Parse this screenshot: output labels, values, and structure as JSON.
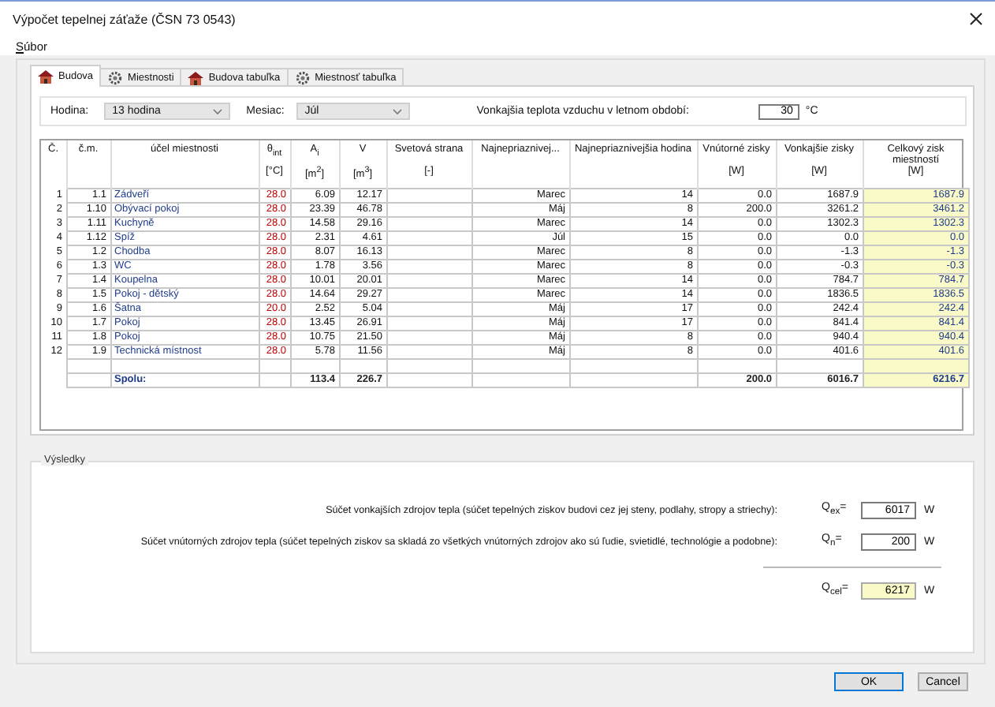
{
  "window": {
    "title": "Výpočet tepelnej záťaže  (ČSN 73 0543)"
  },
  "menu": [
    {
      "label": "Súbor"
    }
  ],
  "tabs": [
    {
      "label": "Budova",
      "kind": "building",
      "selected": true
    },
    {
      "label": "Miestnosti",
      "kind": "rooms",
      "selected": false
    },
    {
      "label": "Budova tabuľka",
      "kind": "building",
      "selected": false
    },
    {
      "label": "Miestnosť tabuľka",
      "kind": "rooms",
      "selected": false
    }
  ],
  "filters": {
    "hour": {
      "label": "Hodina:",
      "value": "13 hodina"
    },
    "month": {
      "label": "Mesiac:",
      "value": "Júl"
    },
    "outdoor_temperature": {
      "label": "Vonkajšia teplota vzduchu v letnom období:",
      "value": "30",
      "unit": "°C"
    }
  },
  "table": {
    "columns": [
      {
        "header": "Č."
      },
      {
        "header": "č.m."
      },
      {
        "header": "účel miestnosti"
      },
      {
        "header": "θ$_{int}$",
        "unit": "[°C]"
      },
      {
        "header": "A$_{i}$",
        "unit": "[m$^{2}$]"
      },
      {
        "header": "V",
        "unit": "[m$^{3}$]"
      },
      {
        "header": "Svetová strana",
        "unit": "[-]"
      },
      {
        "header": "Najnepriaznivej..."
      },
      {
        "header": "Najnepriaznivejšia hodina"
      },
      {
        "header": "Vnútorné zisky",
        "unit": "[W]"
      },
      {
        "header": "Vonkajšie zisky",
        "unit": "[W]"
      },
      {
        "header": "Celkový zisk miestností",
        "unit": "[W]"
      }
    ],
    "rows": [
      [
        "1",
        "1.1",
        "Zádveří",
        "28.0",
        "6.09",
        "12.17",
        null,
        "Marec",
        "14",
        "0.0",
        "1687.9",
        "1687.9"
      ],
      [
        "2",
        "1.10",
        "Obývací pokoj",
        "28.0",
        "23.39",
        "46.78",
        null,
        "Máj",
        "8",
        "200.0",
        "3261.2",
        "3461.2"
      ],
      [
        "3",
        "1.11",
        "Kuchyně",
        "28.0",
        "14.58",
        "29.16",
        null,
        "Marec",
        "14",
        "0.0",
        "1302.3",
        "1302.3"
      ],
      [
        "4",
        "1.12",
        "Spíž",
        "28.0",
        "2.31",
        "4.61",
        null,
        "Júl",
        "15",
        "0.0",
        "0.0",
        "0.0"
      ],
      [
        "5",
        "1.2",
        "Chodba",
        "28.0",
        "8.07",
        "16.13",
        null,
        "Marec",
        "8",
        "0.0",
        "-1.3",
        "-1.3"
      ],
      [
        "6",
        "1.3",
        "WC",
        "28.0",
        "1.78",
        "3.56",
        null,
        "Marec",
        "8",
        "0.0",
        "-0.3",
        "-0.3"
      ],
      [
        "7",
        "1.4",
        "Koupelna",
        "28.0",
        "10.01",
        "20.01",
        null,
        "Marec",
        "14",
        "0.0",
        "784.7",
        "784.7"
      ],
      [
        "8",
        "1.5",
        "Pokoj - dětský",
        "28.0",
        "14.64",
        "29.27",
        null,
        "Marec",
        "14",
        "0.0",
        "1836.5",
        "1836.5"
      ],
      [
        "9",
        "1.6",
        "Šatna",
        "20.0",
        "2.52",
        "5.04",
        null,
        "Máj",
        "17",
        "0.0",
        "242.4",
        "242.4"
      ],
      [
        "10",
        "1.7",
        "Pokoj",
        "28.0",
        "13.45",
        "26.91",
        null,
        "Máj",
        "17",
        "0.0",
        "841.4",
        "841.4"
      ],
      [
        "11",
        "1.8",
        "Pokoj",
        "28.0",
        "10.75",
        "21.50",
        null,
        "Máj",
        "8",
        "0.0",
        "940.4",
        "940.4"
      ],
      [
        "12",
        "1.9",
        "Technická místnost",
        "28.0",
        "5.78",
        "11.56",
        null,
        "Máj",
        "8",
        "0.0",
        "401.6",
        "401.6"
      ]
    ],
    "totals": {
      "label": "Spolu:",
      "area": "113.4",
      "volume": "226.7",
      "internal_gains": "200.0",
      "external_gains": "6016.7",
      "total_gains": "6216.7"
    }
  },
  "results": {
    "title": "Výsledky",
    "items": [
      {
        "kind": "input",
        "label": "Súčet vonkajších zdrojov tepla (súčet tepelných ziskov budovi cez jej steny, podlahy, stropy a striechy):",
        "symbol": "Q$_{ex}$=",
        "value": "6017",
        "unit": "W"
      },
      {
        "kind": "input",
        "label": "Súčet vnútorných zdrojov tepla (súčet tepelných ziskov sa skladá zo všetkých vnútorných zdrojov ako sú ľudie, svietidlé, technológie a podobne):",
        "symbol": "Q$_{n}$=",
        "value": "200",
        "unit": "W"
      },
      {
        "kind": "total",
        "symbol": "Q$_{cel}$=",
        "value": "6217",
        "unit": "W"
      }
    ]
  },
  "buttons": [
    {
      "label": "OK",
      "kind": "default"
    },
    {
      "label": "Cancel",
      "kind": "normal"
    }
  ]
}
